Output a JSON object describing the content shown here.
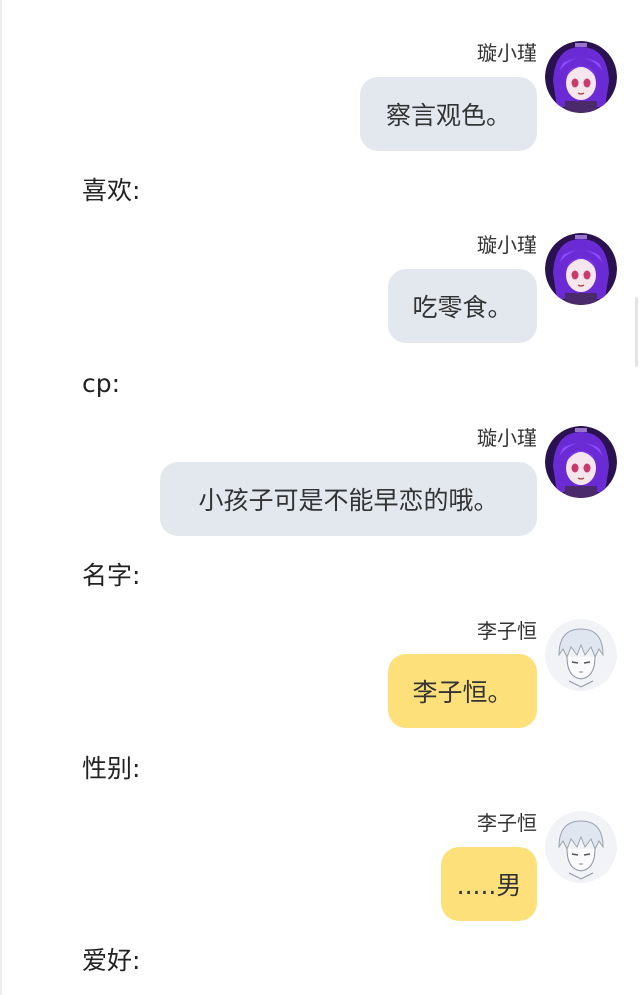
{
  "conversation": [
    {
      "speaker": "璇小瑾",
      "text": "察言观色。",
      "bubble_color": "#e3e8ef",
      "avatar_icon": "purple-anime-girl-avatar"
    },
    {
      "label": "喜欢:"
    },
    {
      "speaker": "璇小瑾",
      "text": "吃零食。",
      "bubble_color": "#e3e8ef",
      "avatar_icon": "purple-anime-girl-avatar"
    },
    {
      "label": "cp:"
    },
    {
      "speaker": "璇小瑾",
      "text": "小孩子可是不能早恋的哦。",
      "bubble_color": "#e3e8ef",
      "avatar_icon": "purple-anime-girl-avatar"
    },
    {
      "label": "名字:"
    },
    {
      "speaker": "李子恒",
      "text": "李子恒。",
      "bubble_color": "#fde07a",
      "avatar_icon": "white-haired-boy-avatar"
    },
    {
      "label": "性别:"
    },
    {
      "speaker": "李子恒",
      "text": ".....男",
      "bubble_color": "#fde07a",
      "avatar_icon": "white-haired-boy-avatar"
    },
    {
      "label": "爱好:"
    }
  ]
}
